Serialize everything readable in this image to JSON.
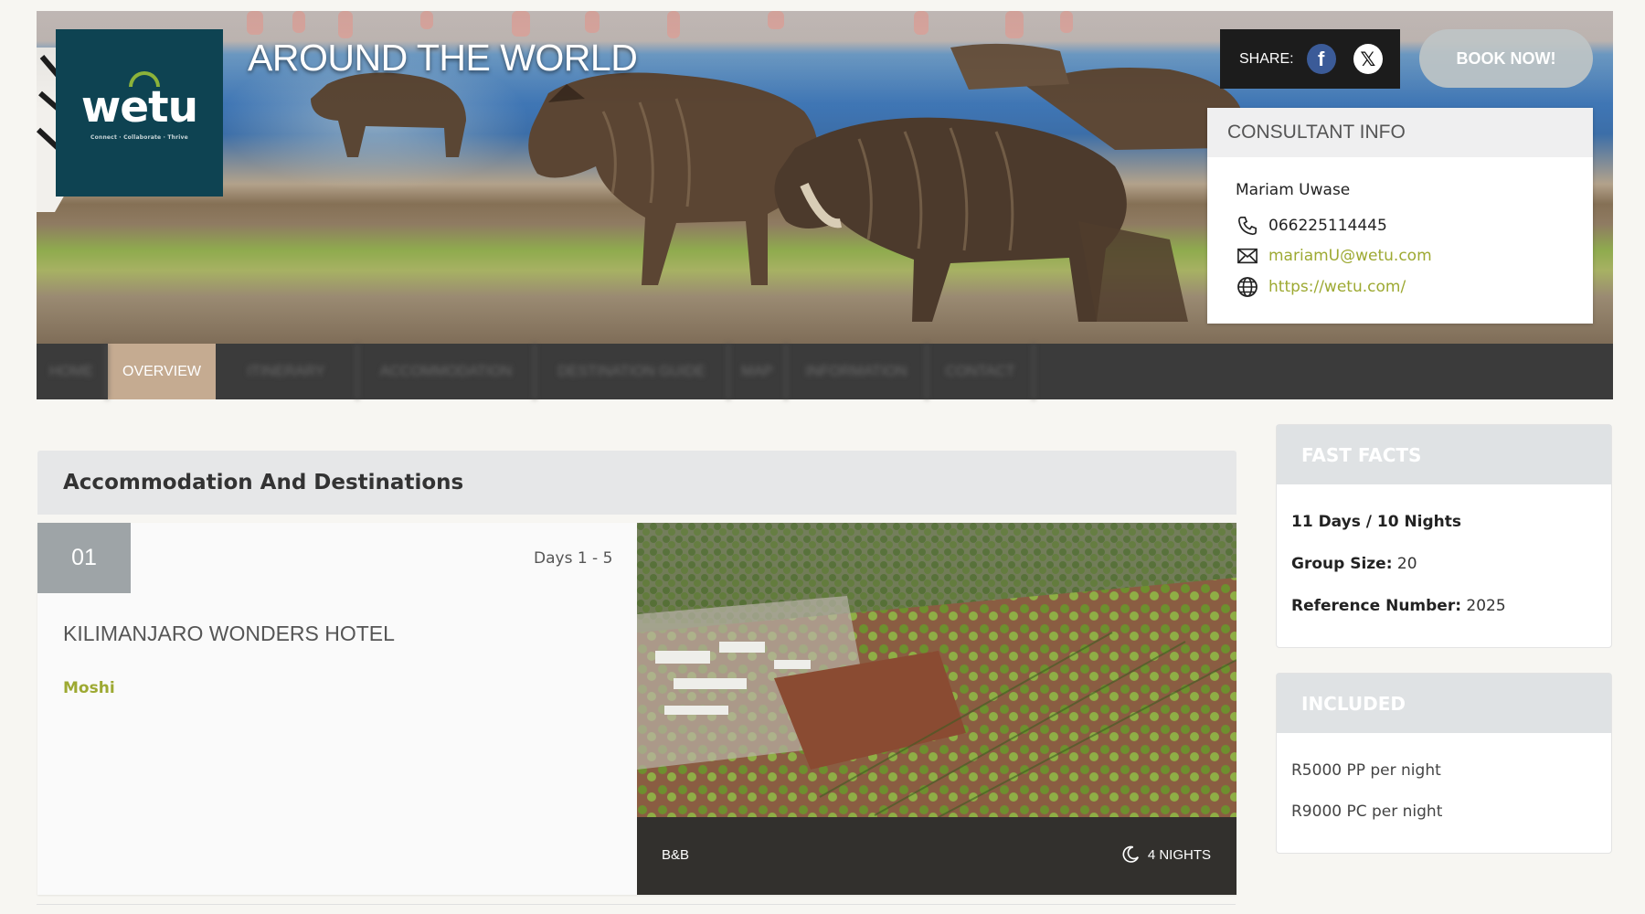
{
  "site": {
    "title": "AROUND THE WORLD",
    "logo": {
      "word": "wetu",
      "tagline": "Connect · Collaborate · Thrive"
    }
  },
  "share": {
    "label": "SHARE:",
    "icons": [
      "facebook-icon",
      "x-icon"
    ]
  },
  "book_now": "BOOK NOW!",
  "consultant": {
    "heading": "CONSULTANT INFO",
    "name": "Mariam Uwase",
    "phone": "066225114445",
    "email": "mariamU@wetu.com",
    "website": "https://wetu.com/"
  },
  "nav": {
    "tabs": [
      {
        "label": "HOME",
        "active": false
      },
      {
        "label": "OVERVIEW",
        "active": true
      },
      {
        "label": "ITINERARY",
        "active": false
      },
      {
        "label": "ACCOMMODATION",
        "active": false
      },
      {
        "label": "DESTINATION GUIDE",
        "active": false
      },
      {
        "label": "MAP",
        "active": false
      },
      {
        "label": "INFORMATION",
        "active": false
      },
      {
        "label": "CONTACT",
        "active": false
      }
    ]
  },
  "section": {
    "title": "Accommodation And Destinations"
  },
  "stay": {
    "index": "01",
    "days": "Days 1 - 5",
    "hotel": "KILIMANJARO WONDERS HOTEL",
    "location": "Moshi",
    "board": "B&B",
    "nights": "4 NIGHTS"
  },
  "fast_facts": {
    "heading": "FAST FACTS",
    "duration": "11 Days / 10 Nights",
    "group_label": "Group Size:",
    "group_value": "20",
    "ref_label": "Reference Number:",
    "ref_value": "2025"
  },
  "included": {
    "heading": "INCLUDED",
    "items": [
      "R5000 PP per night",
      "R9000 PC per night"
    ]
  },
  "colors": {
    "accent_green": "#9da932",
    "nav_active": "#c5ab91",
    "logo_bg": "#0e4352"
  }
}
